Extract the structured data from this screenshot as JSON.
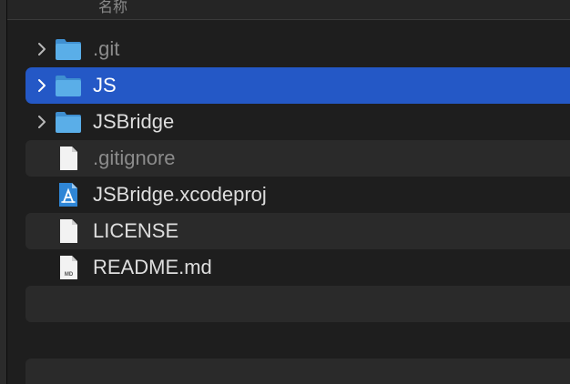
{
  "header": {
    "column_label": "名称"
  },
  "files": [
    {
      "name": ".git",
      "kind": "folder",
      "icon": "folder-icon",
      "expandable": true,
      "hidden": true,
      "selected": false
    },
    {
      "name": "JS",
      "kind": "folder",
      "icon": "folder-icon",
      "expandable": true,
      "hidden": false,
      "selected": true
    },
    {
      "name": "JSBridge",
      "kind": "folder",
      "icon": "folder-icon",
      "expandable": true,
      "hidden": false,
      "selected": false
    },
    {
      "name": ".gitignore",
      "kind": "file",
      "icon": "document-icon",
      "expandable": false,
      "hidden": true,
      "selected": false
    },
    {
      "name": "JSBridge.xcodeproj",
      "kind": "xcode-project",
      "icon": "xcodeproj-icon",
      "expandable": false,
      "hidden": false,
      "selected": false
    },
    {
      "name": "LICENSE",
      "kind": "file",
      "icon": "document-icon",
      "expandable": false,
      "hidden": false,
      "selected": false
    },
    {
      "name": "README.md",
      "kind": "markdown",
      "icon": "markdown-file-icon",
      "icon_badge": "MD",
      "expandable": false,
      "hidden": false,
      "selected": false
    }
  ],
  "colors": {
    "selection": "#2458c6",
    "folder": "#5aaee8",
    "alt_row": "#2a2a2a",
    "text": "#dedede",
    "hidden_text": "#8b8b8b"
  }
}
